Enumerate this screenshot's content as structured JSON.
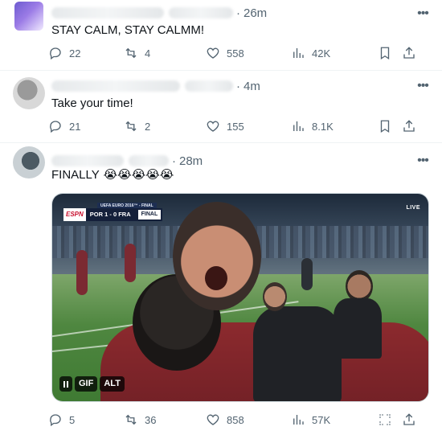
{
  "tweets": [
    {
      "time": "26m",
      "text": "STAY CALM, STAY CALMM!",
      "stats": {
        "replies": "22",
        "reposts": "4",
        "likes": "558",
        "views": "42K"
      }
    },
    {
      "time": "4m",
      "text": "Take your time!",
      "stats": {
        "replies": "21",
        "reposts": "2",
        "likes": "155",
        "views": "8.1K"
      }
    },
    {
      "time": "28m",
      "text": "FINALLY",
      "emoji": "😭😭😭😭😭",
      "stats": {
        "replies": "5",
        "reposts": "36",
        "likes": "858",
        "views": "57K"
      },
      "media": {
        "scoreboard": {
          "brand": "ESPN",
          "header": "UEFA EURO 2016™ - FINAL",
          "score": "POR 1 - 0 FRA",
          "status": "FINAL"
        },
        "live_badge": "LIVE",
        "gif_label": "GIF",
        "alt_label": "ALT"
      }
    }
  ],
  "icons": [
    "reply-icon",
    "repost-icon",
    "like-icon",
    "views-icon",
    "bookmark-icon",
    "share-icon",
    "more-icon",
    "expand-icon"
  ],
  "colors": {
    "text": "#0f1419",
    "secondary": "#536471",
    "divider": "#eff3f4"
  }
}
